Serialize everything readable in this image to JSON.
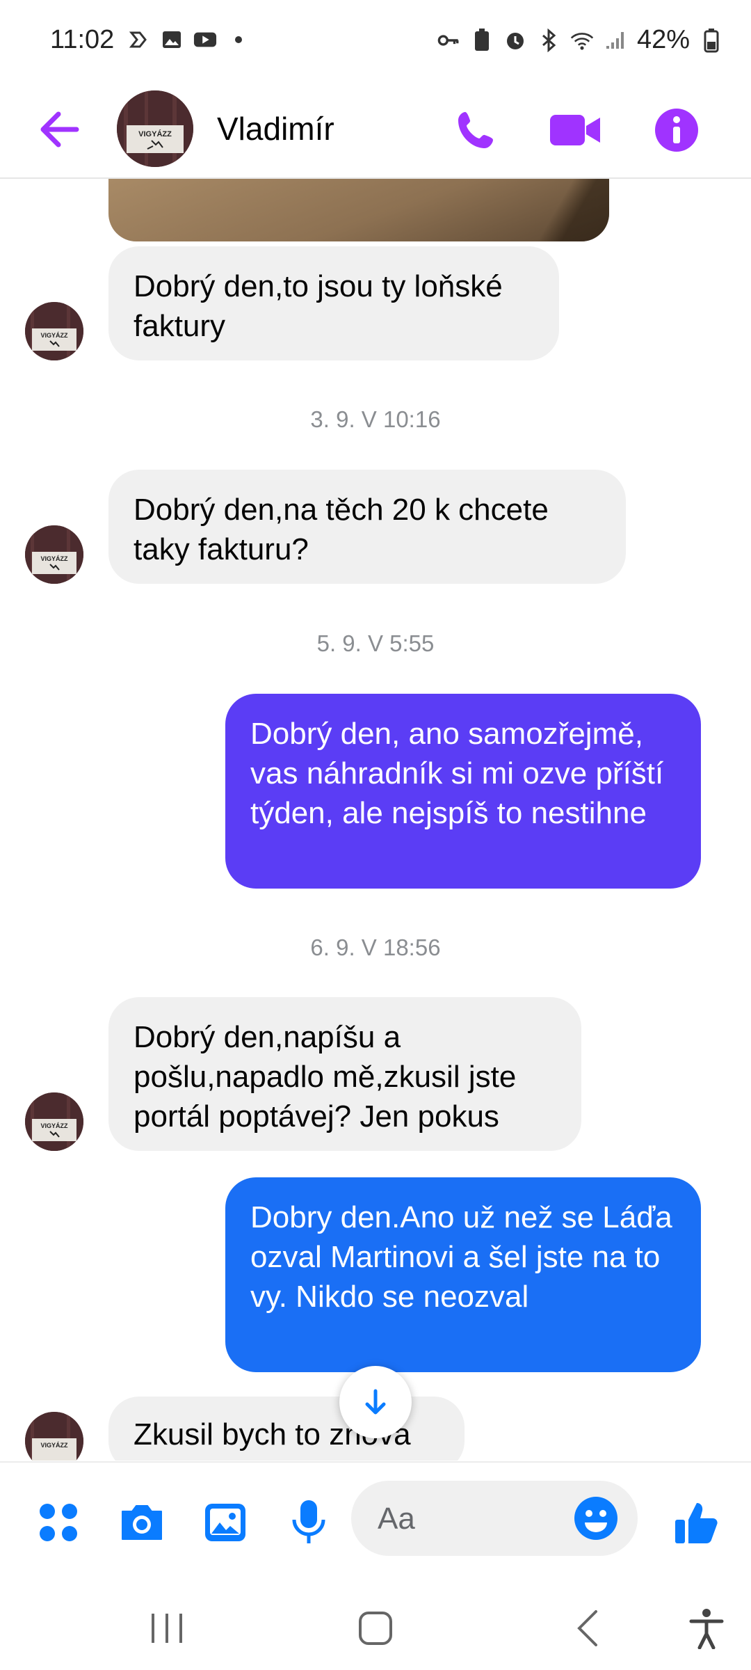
{
  "status_bar": {
    "time": "11:02",
    "battery": "42%"
  },
  "header": {
    "contact_name": "Vladimír"
  },
  "avatar_text": "VIGYÁZZ",
  "messages": [
    {
      "direction": "in",
      "text": "Dobrý den,to jsou ty loňské faktury"
    },
    {
      "type": "timestamp",
      "text": "3. 9. V 10:16"
    },
    {
      "direction": "in",
      "text": "Dobrý den,na těch 20 k chcete taky fakturu?"
    },
    {
      "type": "timestamp",
      "text": "5. 9. V 5:55"
    },
    {
      "direction": "out",
      "text": "Dobrý den, ano samozřejmě, vas náhradník si mi ozve příští týden, ale nejspíš to nestihne"
    },
    {
      "type": "timestamp",
      "text": "6. 9. V 18:56"
    },
    {
      "direction": "in",
      "text": "Dobrý den,napíšu a pošlu,napadlo mě,zkusil jste portál poptávej? Jen pokus"
    },
    {
      "direction": "out",
      "text": "Dobry den.Ano už než se Láďa ozval Martinovi a šel jste na to vy. Nikdo se neozval"
    },
    {
      "direction": "in",
      "text": "Zkusil bych to znova"
    }
  ],
  "composer": {
    "placeholder": "Aa"
  },
  "colors": {
    "accent": "#a033ff",
    "blue": "#0a7cff",
    "out_bubble_1": "#5b3df5",
    "out_bubble_2": "#1a6ff5",
    "in_bubble": "#f0f0f0"
  },
  "icons": {
    "header": [
      "back-arrow-icon",
      "phone-icon",
      "video-camera-icon",
      "info-icon"
    ],
    "composer": [
      "apps-grid-icon",
      "camera-icon",
      "gallery-icon",
      "microphone-icon",
      "emoji-icon",
      "thumbs-up-icon"
    ],
    "nav": [
      "recents-icon",
      "home-icon",
      "back-icon",
      "accessibility-icon"
    ]
  }
}
